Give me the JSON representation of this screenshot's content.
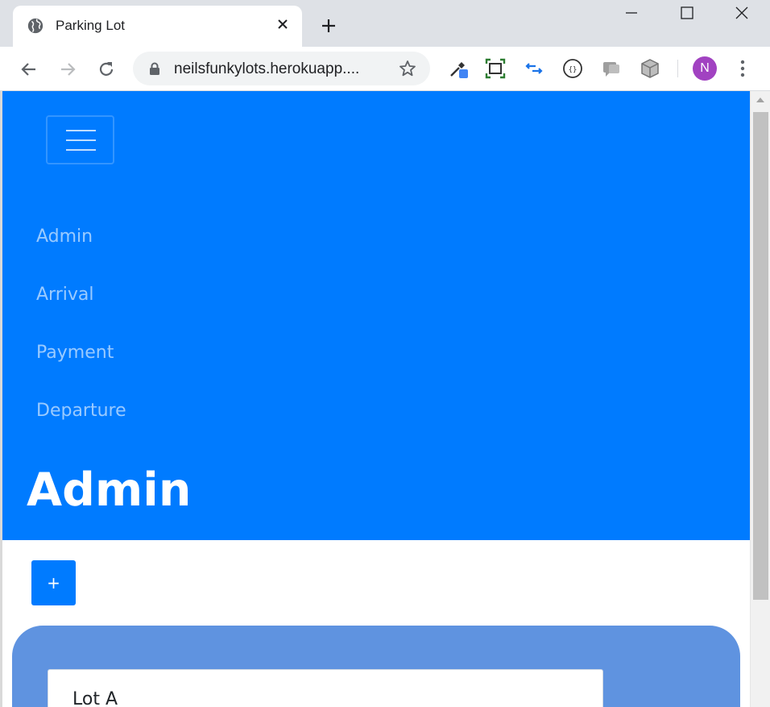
{
  "browser": {
    "tab_title": "Parking Lot",
    "url": "neilsfunkylots.herokuapp....",
    "profile_initial": "N",
    "profile_color": "#a142c1"
  },
  "page": {
    "nav_links": [
      "Admin",
      "Arrival",
      "Payment",
      "Departure"
    ],
    "title": "Admin",
    "add_button_label": "+",
    "lots": [
      "Lot A"
    ],
    "colors": {
      "primary": "#007bff",
      "panel": "#5f93e0"
    }
  }
}
